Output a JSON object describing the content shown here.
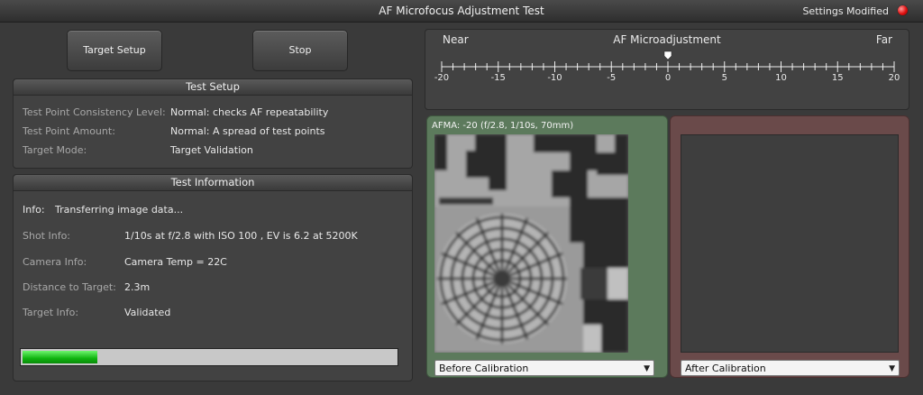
{
  "window": {
    "title": "AF Microfocus Adjustment Test",
    "settings_modified": "Settings Modified"
  },
  "toolbar": {
    "target_setup": "Target Setup",
    "stop": "Stop"
  },
  "test_setup": {
    "header": "Test Setup",
    "rows": [
      {
        "label": "Test Point Consistency Level:",
        "value": "Normal: checks AF repeatability"
      },
      {
        "label": "Test Point Amount:",
        "value": "Normal: A spread of test points"
      },
      {
        "label": "Target Mode:",
        "value": "Target Validation"
      }
    ]
  },
  "test_info": {
    "header": "Test Information",
    "info_label": "Info:",
    "info_value": "Transferring image data...",
    "rows": [
      {
        "label": "Shot Info:",
        "value": "1/10s at f/2.8 with ISO 100 , EV is 6.2 at 5200K"
      },
      {
        "label": "Camera Info:",
        "value": "Camera Temp = 22C"
      },
      {
        "label": "Distance to Target:",
        "value": "2.3m"
      },
      {
        "label": "Target Info:",
        "value": "Validated"
      }
    ],
    "progress_fraction": 0.2
  },
  "afma": {
    "near": "Near",
    "title": "AF Microadjustment",
    "far": "Far",
    "min": -20,
    "max": 20,
    "current": 0,
    "tick_labels": [
      "-20",
      "-15",
      "-10",
      "-5",
      "0",
      "5",
      "10",
      "15",
      "20"
    ]
  },
  "before": {
    "caption": "AFMA: -20 (f/2.8, 1/10s, 70mm)",
    "select_value": "Before Calibration"
  },
  "after": {
    "select_value": "After Calibration"
  },
  "colors": {
    "accent_green": "#0fb40f",
    "status_red": "#e01010"
  }
}
